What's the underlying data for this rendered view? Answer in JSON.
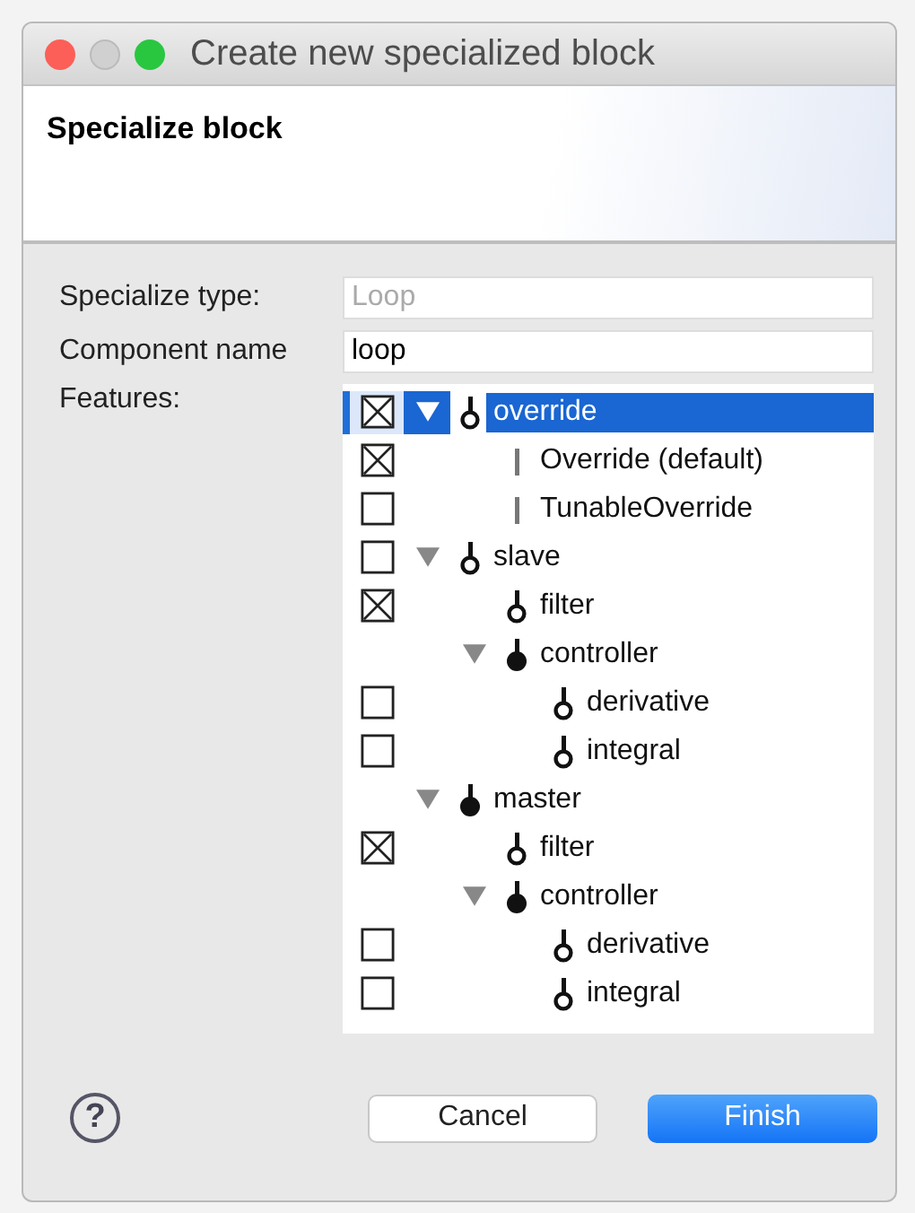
{
  "window": {
    "title": "Create new specialized block"
  },
  "header": {
    "title": "Specialize block"
  },
  "form": {
    "fields": [
      {
        "label": "Specialize type:",
        "placeholder": "Loop"
      },
      {
        "label": "Component name",
        "value": "loop"
      }
    ],
    "features_label": "Features:"
  },
  "features": [
    {
      "label": "override",
      "kind": "hollow",
      "checked": true,
      "expanded": true,
      "selected": true,
      "children": [
        {
          "label": "Override (default)",
          "kind": "bar",
          "checked": true,
          "selected": false
        },
        {
          "label": "TunableOverride",
          "kind": "bar",
          "checked": false,
          "selected": false
        }
      ]
    },
    {
      "label": "slave",
      "kind": "hollow",
      "checked": false,
      "expanded": true,
      "selected": false,
      "children": [
        {
          "label": "filter",
          "kind": "hollow",
          "checked": true,
          "selected": false
        },
        {
          "label": "controller",
          "kind": "solid",
          "expanded": true,
          "selected": false,
          "children": [
            {
              "label": "derivative",
              "kind": "hollow",
              "checked": false,
              "selected": false
            },
            {
              "label": "integral",
              "kind": "hollow",
              "checked": false,
              "selected": false
            }
          ]
        }
      ]
    },
    {
      "label": "master",
      "kind": "solid",
      "expanded": true,
      "selected": false,
      "children": [
        {
          "label": "filter",
          "kind": "hollow",
          "checked": true,
          "selected": false
        },
        {
          "label": "controller",
          "kind": "solid",
          "expanded": true,
          "selected": false,
          "children": [
            {
              "label": "derivative",
              "kind": "hollow",
              "checked": false,
              "selected": false
            },
            {
              "label": "integral",
              "kind": "hollow",
              "checked": false,
              "selected": false
            }
          ]
        }
      ]
    }
  ],
  "footer": {
    "help": "?",
    "buttons": [
      {
        "label": "Cancel",
        "kind": "secondary"
      },
      {
        "label": "Finish",
        "kind": "primary"
      }
    ]
  }
}
